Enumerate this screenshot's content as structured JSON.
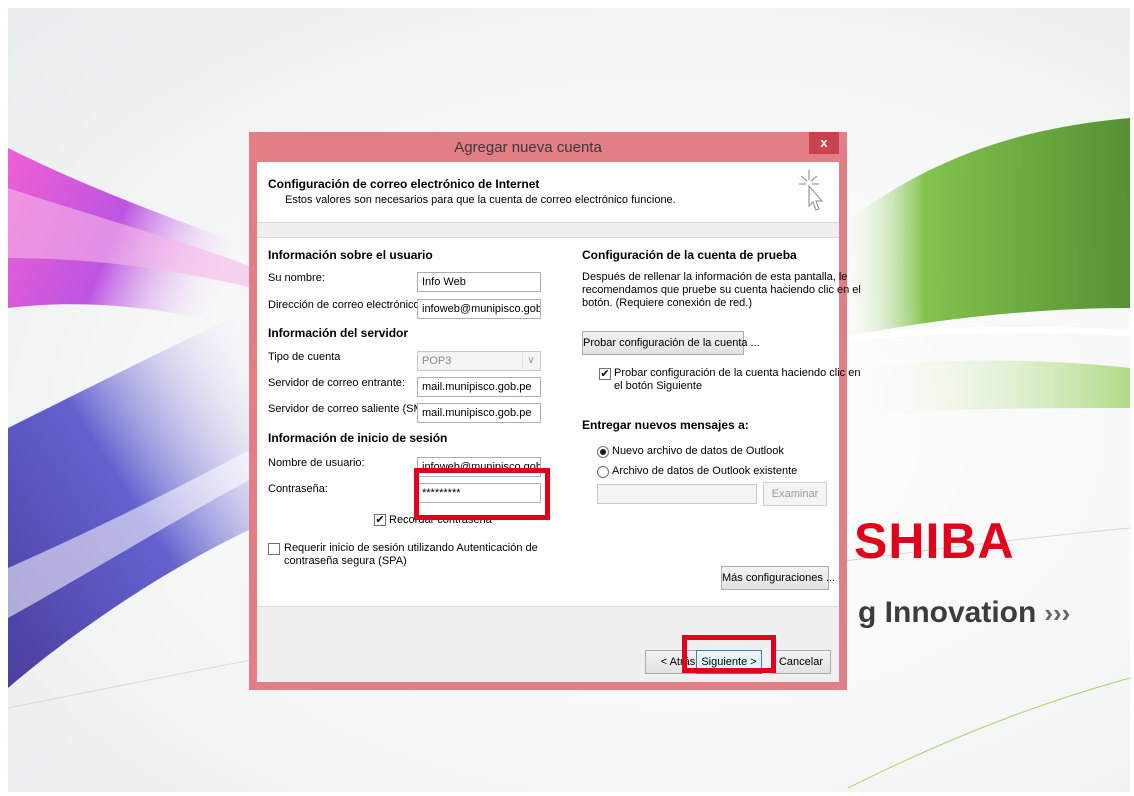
{
  "wallpaper": {
    "brand_text": "SHIBA",
    "tagline_text": "g Innovation",
    "tagline_chevrons": "›››"
  },
  "dialog": {
    "title": "Agregar nueva cuenta",
    "close_glyph": "x",
    "header_title": "Configuración de correo electrónico de Internet",
    "header_subtitle": "Estos valores son necesarios para que la cuenta de correo electrónico funcione.",
    "user_section": {
      "heading": "Información sobre el usuario",
      "name_label": "Su nombre:",
      "name_value": "Info Web",
      "email_label": "Dirección de correo electrónico:",
      "email_value": "infoweb@munipisco.gob.pe"
    },
    "server_section": {
      "heading": "Información del servidor",
      "account_type_label": "Tipo de cuenta",
      "account_type_value": "POP3",
      "incoming_label": "Servidor de correo entrante:",
      "incoming_value": "mail.munipisco.gob.pe",
      "outgoing_label": "Servidor de correo saliente (SMTP):",
      "outgoing_value": "mail.munipisco.gob.pe"
    },
    "login_section": {
      "heading": "Información de inicio de sesión",
      "username_label": "Nombre de usuario:",
      "username_value": "infoweb@munipisco.gob.pe",
      "password_label": "Contraseña:",
      "password_value": "*********",
      "remember_label": "Recordar contraseña",
      "remember_checked": true,
      "spa_label_line1": "Requerir inicio de sesión utilizando Autenticación de",
      "spa_label_line2": "contraseña segura (SPA)",
      "spa_checked": false
    },
    "test_section": {
      "heading": "Configuración de la cuenta de prueba",
      "desc_line1": "Después de rellenar la información de esta pantalla, le",
      "desc_line2": "recomendamos que pruebe su cuenta haciendo clic en el",
      "desc_line3": "botón. (Requiere conexión de red.)",
      "test_button": "Probar configuración de la cuenta ...",
      "auto_test_line1": "Probar configuración de la cuenta haciendo clic en",
      "auto_test_line2": "el botón Siguiente",
      "auto_test_checked": true
    },
    "deliver_section": {
      "heading": "Entregar nuevos mensajes a:",
      "option_new": "Nuevo archivo de datos de Outlook",
      "option_existing": "Archivo de datos de Outlook existente",
      "selected": "new",
      "path_value": "",
      "browse_button": "Examinar"
    },
    "more_settings_button": "Más configuraciones ...",
    "footer": {
      "back_button": "< Atrás",
      "next_button": "Siguiente >",
      "cancel_button": "Cancelar"
    }
  },
  "colors": {
    "titlebar": "#e27e86",
    "close": "#c8434f",
    "highlight": "#e0001b",
    "brand": "#e2001a"
  }
}
